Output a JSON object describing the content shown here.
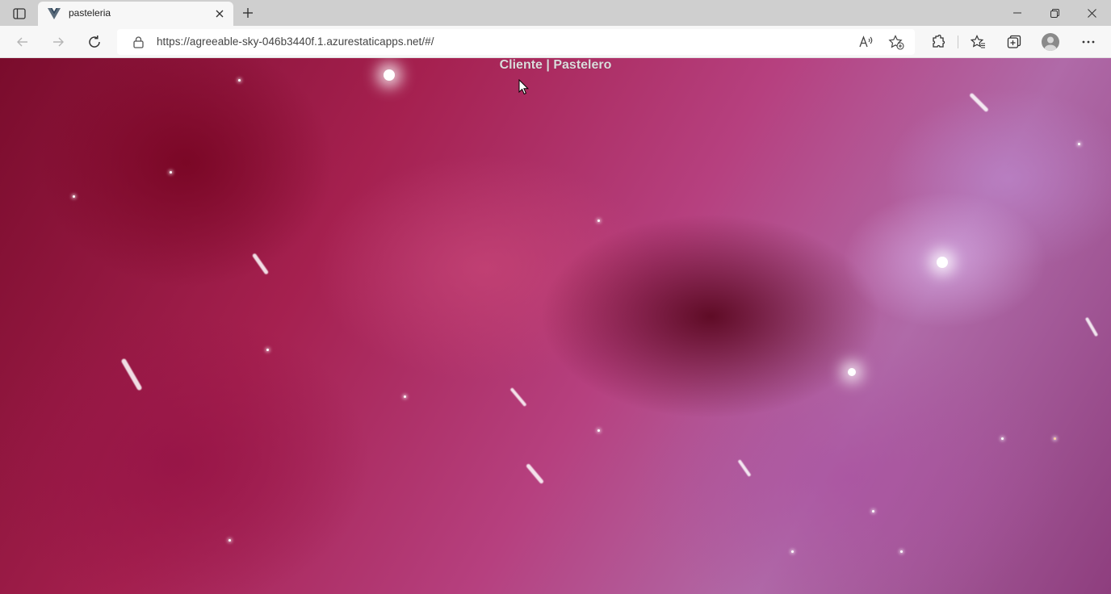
{
  "colors": {
    "tabstrip_bg": "#cfcfcf",
    "toolbar_bg": "#f7f7f7",
    "nav_text": "#dcdcdc"
  },
  "window": {
    "tab_actions_icon": "tab-actions-icon",
    "controls": [
      "minimize-icon",
      "restore-icon",
      "close-icon"
    ]
  },
  "tab": {
    "title": "pasteleria",
    "favicon": "vue-logo-icon",
    "close_icon": "close-icon"
  },
  "new_tab_icon": "plus-icon",
  "toolbar": {
    "back_icon": "back-arrow-icon",
    "forward_icon": "forward-arrow-icon",
    "refresh_icon": "refresh-icon",
    "url": "https://agreeable-sky-046b3440f.1.azurestaticapps.net/#/",
    "read_aloud_icon": "read-aloud-icon",
    "add_favorite_icon": "add-favorite-icon",
    "extensions_icon": "extensions-icon",
    "favorites_icon": "favorites-icon",
    "collections_icon": "collections-icon",
    "profile_icon": "profile-avatar",
    "menu_icon": "more-icon"
  },
  "page": {
    "nav": {
      "cliente": "Cliente",
      "separator": "|",
      "pastelero": "Pastelero"
    }
  }
}
